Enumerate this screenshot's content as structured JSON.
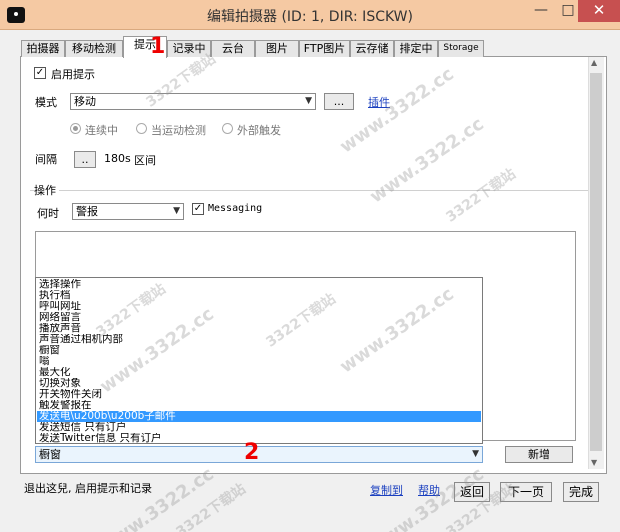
{
  "window": {
    "title": "编辑拍摄器 (ID: 1, DIR: ISCKW)",
    "min": "—",
    "max": "□",
    "close": "✕"
  },
  "tabs": [
    "拍摄器",
    "移动检测",
    "提示",
    "记录中",
    "云台",
    "图片",
    "FTP图片",
    "云存储",
    "排定中",
    "Storage"
  ],
  "active_tab": "提示",
  "markers": {
    "one": "1",
    "two": "2"
  },
  "alerts": {
    "enable_label": "启用提示",
    "enable_checked": "✓",
    "mode_label": "模式",
    "mode_value": "移动",
    "mode_btn": "...",
    "plugin_link": "插件",
    "radios": [
      "连续中",
      "当运动检测",
      "外部触发"
    ],
    "interval_label": "间隔",
    "interval_btn": "..",
    "interval_value": "180s",
    "interval_unit": "区间"
  },
  "action": {
    "group_label": "操作",
    "when_label": "何时",
    "when_value": "警报",
    "messaging_checked": "✓",
    "messaging_label": "Messaging",
    "dropdown_items": [
      "选择操作",
      "执行档",
      "呼叫网址",
      "网络留言",
      "播放声音",
      "声音通过相机内部",
      "橱窗",
      "嗡",
      "最大化",
      "切换对象",
      "开关物件关闭",
      "触发警报在",
      "发送电\\u200b\\u200b子邮件",
      "发送短信 只有订户",
      "发送Twitter信息 只有订户"
    ],
    "selected_index": 12,
    "combo_value": "橱窗",
    "add_button": "新增"
  },
  "footer": {
    "status": "退出这兒, 启用提示和记录",
    "copy_link": "复制到",
    "help_link": "帮助",
    "back": "返回",
    "next": "下一页",
    "done": "完成"
  },
  "watermark": "www.3322.cc",
  "watermark2": "3322下载站"
}
